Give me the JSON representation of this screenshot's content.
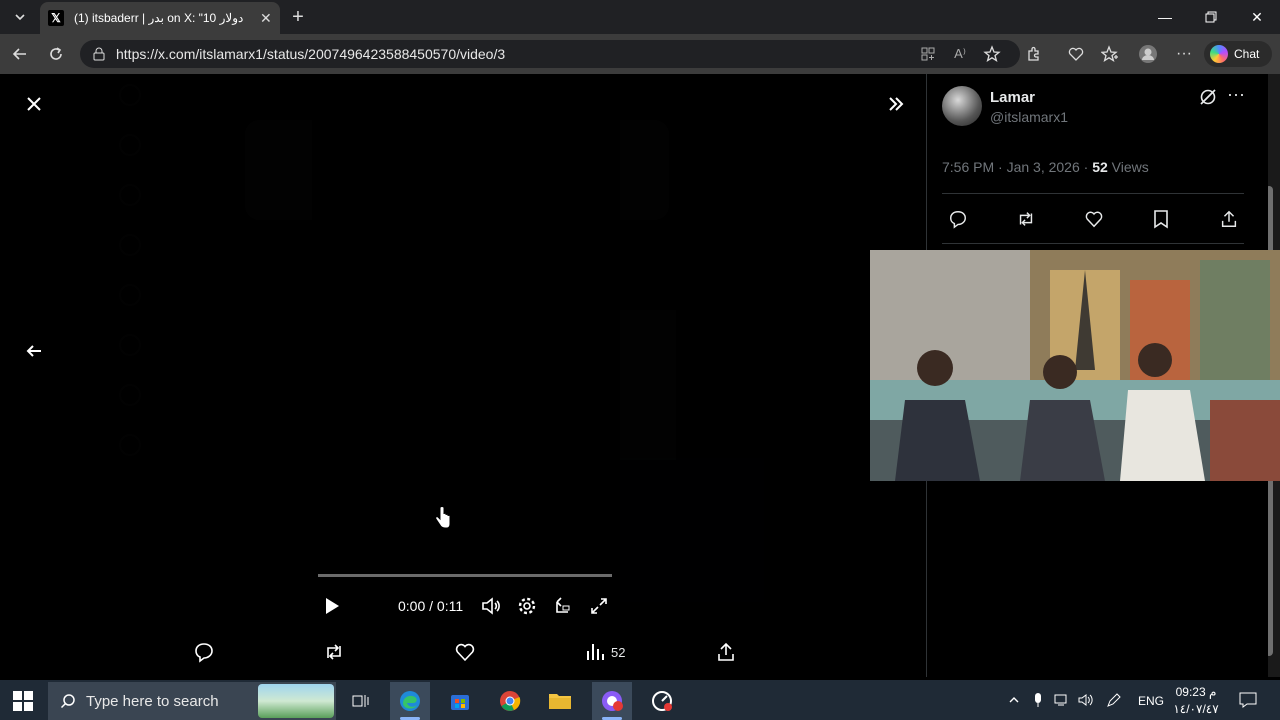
{
  "browser": {
    "tab_title": "(1) itsbaderr | بدر on X: \"10 دولار",
    "url": "https://x.com/itslamarx1/status/2007496423588450570/video/3",
    "chat_label": "Chat"
  },
  "player": {
    "time": "0:00 / 0:11",
    "views": "52"
  },
  "post": {
    "author_name": "Lamar",
    "author_handle": "@itslamarx1",
    "timestamp": "7:56 PM · Jan 3, 2026 · ",
    "view_count": "52",
    "views_label": " Views"
  },
  "taskbar": {
    "search_placeholder": "Type here to search",
    "language": "ENG",
    "time": "09:23 م",
    "date": "١٤/٠٧/٤٧"
  },
  "colors": {
    "x_text": "#e7e9ea",
    "x_secondary": "#71767b",
    "edge_accent": "#8ab4f8"
  }
}
